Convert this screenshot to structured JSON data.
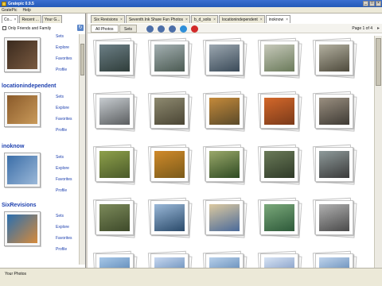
{
  "window": {
    "title": "Gratepic 0.9.5",
    "buttons": [
      "_",
      "□",
      "×"
    ]
  },
  "menu": [
    "GratePic",
    "Help"
  ],
  "left_tabs": [
    {
      "label": "Co...",
      "close": "×",
      "active": true
    },
    {
      "label": "Recent ...",
      "close": "",
      "active": false
    },
    {
      "label": "Your G...",
      "close": "",
      "active": false
    }
  ],
  "filter": {
    "label": "Only Friends and Family"
  },
  "contacts": [
    {
      "name": "",
      "links": [
        "Sets",
        "Explore",
        "Favorites",
        "Profile"
      ],
      "colors": [
        "#3a2a1e",
        "#7a5a40"
      ]
    },
    {
      "name": "locationindependent",
      "links": [
        "Sets",
        "Explore",
        "Favorites",
        "Profile"
      ],
      "colors": [
        "#8a5a2a",
        "#c99a5a"
      ]
    },
    {
      "name": "inoknow",
      "links": [
        "Sets",
        "Explore",
        "Favorites",
        "Profile"
      ],
      "colors": [
        "#3b6ea8",
        "#9bb8d8"
      ]
    },
    {
      "name": "SixRevisions",
      "links": [
        "Sets",
        "Explore",
        "Favorites",
        "Profile"
      ],
      "colors": [
        "#2a6fb0",
        "#d68a3a"
      ]
    }
  ],
  "right_tabs": [
    {
      "label": "Six Revisions",
      "close": "×",
      "active": false
    },
    {
      "label": "Seventh.Ink Share Fun Photos",
      "close": "×",
      "active": false
    },
    {
      "label": "b_d_solis",
      "close": "×",
      "active": false
    },
    {
      "label": "locationindependent",
      "close": "×",
      "active": false
    },
    {
      "label": "inoknow",
      "close": "×",
      "active": true
    }
  ],
  "toolbar": {
    "all_photos": "All Photos",
    "sets": "Sets",
    "page_info": "Page 1 of 4",
    "icons": [
      {
        "name": "back-icon",
        "color": "#4d6fa8"
      },
      {
        "name": "forward-icon",
        "color": "#4d6fa8"
      },
      {
        "name": "refresh-icon",
        "color": "#4d6fa8"
      },
      {
        "name": "globe-icon",
        "color": "#2f8fd8"
      },
      {
        "name": "favorite-heart-icon",
        "color": "#d22a2a"
      }
    ]
  },
  "photos": [
    [
      "#2f3d3a",
      "#6c7f86"
    ],
    [
      "#4b5a52",
      "#a4b0b2"
    ],
    [
      "#3a4a58",
      "#9ca7b0"
    ],
    [
      "#6a7a5a",
      "#c7c9bb"
    ],
    [
      "#4e4a3c",
      "#b3b0a0"
    ],
    [
      "#5b5e60",
      "#c7ccd0"
    ],
    [
      "#4a4534",
      "#8e8a70"
    ],
    [
      "#5a4a2a",
      "#c58a3a"
    ],
    [
      "#7a3a1a",
      "#d4682a"
    ],
    [
      "#3e3a34",
      "#9a8f80"
    ],
    [
      "#4a5a2a",
      "#8ea04a"
    ],
    [
      "#7a5a1a",
      "#d08a2a"
    ],
    [
      "#2e4a22",
      "#9aa86a"
    ],
    [
      "#2f3a28",
      "#6a7a58"
    ],
    [
      "#3a3a3a",
      "#8e9a9a"
    ],
    [
      "#3e4a2a",
      "#7c8a5a"
    ],
    [
      "#2a4a6a",
      "#9ab8d8"
    ],
    [
      "#4a6a9a",
      "#dcc9a0"
    ],
    [
      "#2e5a3a",
      "#7aa87a"
    ],
    [
      "#4a4a4a",
      "#b0b0b0"
    ],
    [
      "#3a6aa0",
      "#a8c8e8"
    ],
    [
      "#3a6aa0",
      "#c8d8f0"
    ],
    [
      "#3a6aa0",
      "#b8d0ea"
    ],
    [
      "#5a7ab0",
      "#d8e4f4"
    ],
    [
      "#3a6aa0",
      "#c0d4ec"
    ]
  ],
  "status": "Your Photos"
}
